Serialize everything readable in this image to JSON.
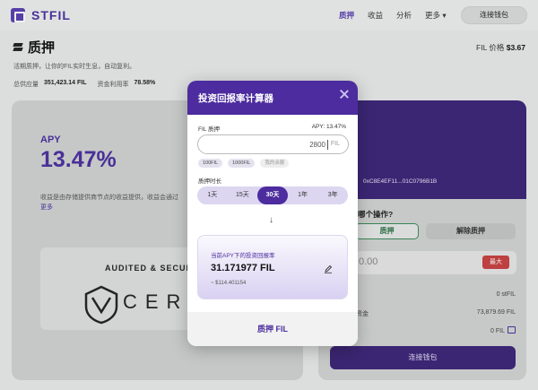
{
  "nav": {
    "brand": "STFIL",
    "items": [
      {
        "label": "质押",
        "active": true
      },
      {
        "label": "收益",
        "active": false
      },
      {
        "label": "分析",
        "active": false
      },
      {
        "label": "更多 ▾",
        "active": false
      }
    ],
    "connect_wallet": "连接钱包"
  },
  "page": {
    "title": "质押",
    "price_label": "FIL 价格",
    "price_value": "$3.67",
    "subtitle": "活期质押，让你的FIL实时生息，自动复利。",
    "total_label": "总供应量",
    "total_value": "351,423.14 FIL",
    "utilization_label": "资金利用率",
    "utilization_value": "78.58%"
  },
  "left_card": {
    "apy_label": "APY",
    "apy_value": "13.47%",
    "note": "收益是由存储提供商节点的收益提供，收益会通过",
    "more": "更多",
    "audit_label": "AUDITED & SECURED",
    "audit_brand": "CERTIK"
  },
  "right_card": {
    "partial_text": "",
    "partial_text2": "",
    "address": "0xC8E4EF11...01C0796B1B",
    "operate_title": "哪个操作?",
    "tab_stake": "质押",
    "tab_unstake": "解除质押",
    "amount_placeholder": "0.00",
    "max_label": "最大",
    "row1_value": "0 stFIL",
    "row2_label": "资金",
    "row2_value": "73,879.69 FIL",
    "row3_value": "0 FIL",
    "connect_wallet": "连接钱包"
  },
  "modal": {
    "title": "投资回报率计算器",
    "fil_label": "FIL 质押",
    "apy_text": "APY: 13.47%",
    "fil_amount": "2800",
    "fil_unit": "FIL",
    "chips": [
      "100FIL",
      "1000FIL",
      "我的余额"
    ],
    "period_label": "质押时长",
    "periods": [
      {
        "label": "1天",
        "active": false
      },
      {
        "label": "15天",
        "active": false
      },
      {
        "label": "30天",
        "active": true
      },
      {
        "label": "1年",
        "active": false
      },
      {
        "label": "3年",
        "active": false
      }
    ],
    "arrow": "↓",
    "result_label": "当前APY下的投资回报率",
    "result_value": "31.171977 FIL",
    "result_usd": "~ $114.401154",
    "stake_button": "质押 FIL"
  }
}
